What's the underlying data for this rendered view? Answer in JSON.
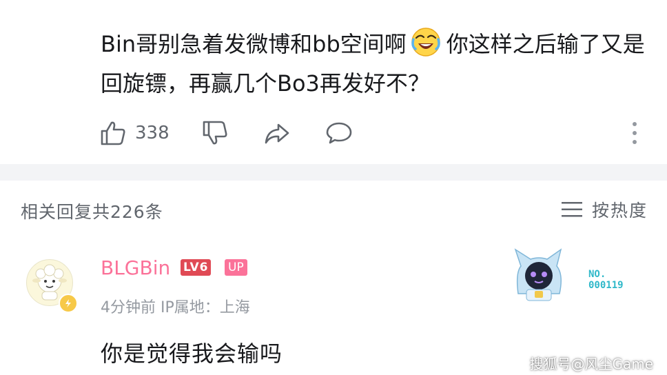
{
  "comment": {
    "text_before_emoji": "Bin哥别急着发微博和bb空间啊",
    "emoji_icon": "crying-laughing-emoji-icon",
    "text_after_emoji": "你这样之后输了又是回旋镖，再赢几个Bo3再发好不？",
    "like_count": "338"
  },
  "replies_header": {
    "count_label": "相关回复共226条",
    "sort_label": "按热度"
  },
  "reply": {
    "username": "BLGBin",
    "level_badge": "LV6",
    "up_badge": "UP",
    "meta": "4分钟前 IP属地：上海",
    "text": "你是觉得我会输吗",
    "fan_badge_no_label": "NO.",
    "fan_badge_number": "000119"
  },
  "watermark": "搜狐号@风尘Game",
  "colors": {
    "username_pink": "#fb7299",
    "level_red": "#e04a55",
    "fan_number_cyan": "#2fb8c9",
    "divider_gray": "#f3f4f6"
  }
}
